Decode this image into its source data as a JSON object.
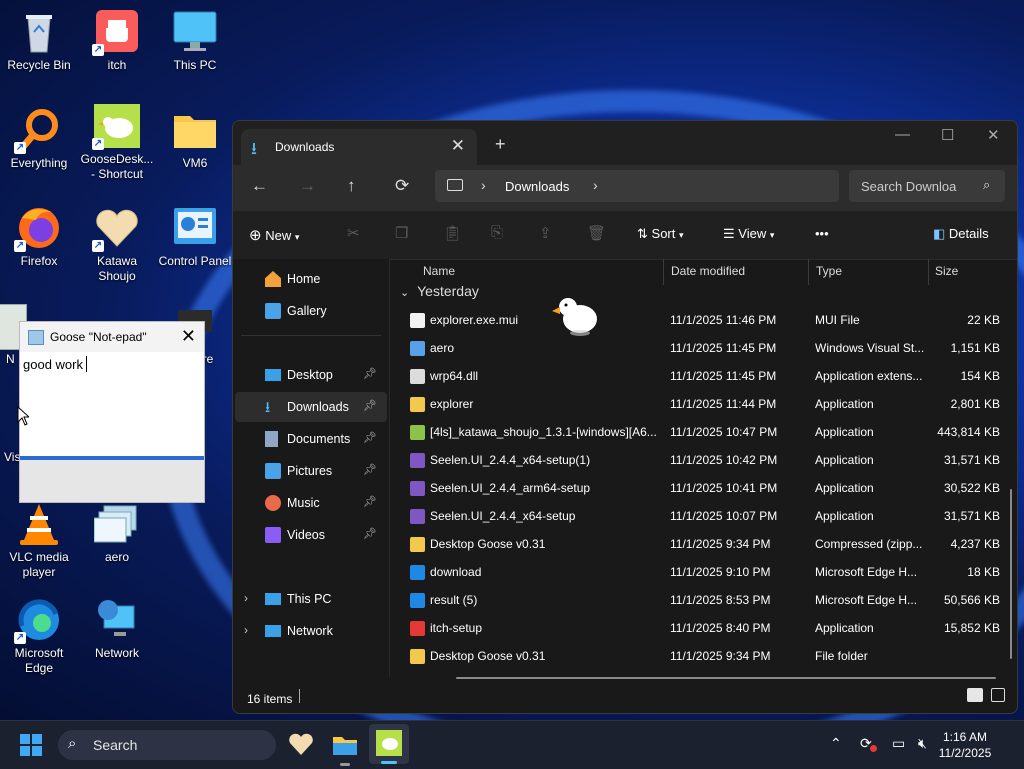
{
  "desktop": {
    "icons": [
      {
        "label": "Recycle Bin"
      },
      {
        "label": "itch"
      },
      {
        "label": "This PC"
      },
      {
        "label": "Everything"
      },
      {
        "label": "GooseDesk... - Shortcut"
      },
      {
        "label": "VM6"
      },
      {
        "label": "Firefox"
      },
      {
        "label": "Katawa Shoujo"
      },
      {
        "label": "Control Panel"
      },
      {
        "label": "Vis"
      },
      {
        "label": "VLC media player"
      },
      {
        "label": "aero"
      },
      {
        "label": "Microsoft Edge"
      },
      {
        "label": "Network"
      },
      {
        "label": "N"
      },
      {
        "label": "ure"
      }
    ]
  },
  "goose_notepad": {
    "title": "Goose \"Not-epad\"",
    "content": "good work"
  },
  "explorer": {
    "tab_title": "Downloads",
    "breadcrumb": "Downloads",
    "search_placeholder": "Search Downloa",
    "toolbar": {
      "new": "New",
      "sort": "Sort",
      "view": "View",
      "more": "•••",
      "details": "Details"
    },
    "nav": {
      "home": "Home",
      "gallery": "Gallery",
      "desktop": "Desktop",
      "downloads": "Downloads",
      "documents": "Documents",
      "pictures": "Pictures",
      "music": "Music",
      "videos": "Videos",
      "this_pc": "This PC",
      "network": "Network"
    },
    "columns": {
      "name": "Name",
      "date": "Date modified",
      "type": "Type",
      "size": "Size"
    },
    "group_label": "Yesterday",
    "files": [
      {
        "name": "explorer.exe.mui",
        "date": "11/1/2025 11:46 PM",
        "type": "MUI File",
        "size": "22 KB",
        "icon_color": "#f2f2f2"
      },
      {
        "name": "aero",
        "date": "11/1/2025 11:45 PM",
        "type": "Windows Visual St...",
        "size": "1,151 KB",
        "icon_color": "#5aa0e6"
      },
      {
        "name": "wrp64.dll",
        "date": "11/1/2025 11:45 PM",
        "type": "Application extens...",
        "size": "154 KB",
        "icon_color": "#dcdcdc"
      },
      {
        "name": "explorer",
        "date": "11/1/2025 11:44 PM",
        "type": "Application",
        "size": "2,801 KB",
        "icon_color": "#f2c94c"
      },
      {
        "name": "[4ls]_katawa_shoujo_1.3.1-[windows][A6...",
        "date": "11/1/2025 10:47 PM",
        "type": "Application",
        "size": "443,814 KB",
        "icon_color": "#8bc34a"
      },
      {
        "name": "Seelen.UI_2.4.4_x64-setup(1)",
        "date": "11/1/2025 10:42 PM",
        "type": "Application",
        "size": "31,571 KB",
        "icon_color": "#7e57c2"
      },
      {
        "name": "Seelen.UI_2.4.4_arm64-setup",
        "date": "11/1/2025 10:41 PM",
        "type": "Application",
        "size": "30,522 KB",
        "icon_color": "#7e57c2"
      },
      {
        "name": "Seelen.UI_2.4.4_x64-setup",
        "date": "11/1/2025 10:07 PM",
        "type": "Application",
        "size": "31,571 KB",
        "icon_color": "#7e57c2"
      },
      {
        "name": "Desktop Goose v0.31",
        "date": "11/1/2025 9:34 PM",
        "type": "Compressed (zipp...",
        "size": "4,237 KB",
        "icon_color": "#f2c94c"
      },
      {
        "name": "download",
        "date": "11/1/2025 9:10 PM",
        "type": "Microsoft Edge H...",
        "size": "18 KB",
        "icon_color": "#1e88e5"
      },
      {
        "name": "result (5)",
        "date": "11/1/2025 8:53 PM",
        "type": "Microsoft Edge H...",
        "size": "50,566 KB",
        "icon_color": "#1e88e5"
      },
      {
        "name": "itch-setup",
        "date": "11/1/2025 8:40 PM",
        "type": "Application",
        "size": "15,852 KB",
        "icon_color": "#e53935"
      },
      {
        "name": "Desktop Goose v0.31",
        "date": "11/1/2025 9:34 PM",
        "type": "File folder",
        "size": "",
        "icon_color": "#f2c94c"
      }
    ],
    "status": "16 items"
  },
  "taskbar": {
    "search_label": "Search",
    "time": "1:16 AM",
    "date": "11/2/2025"
  }
}
